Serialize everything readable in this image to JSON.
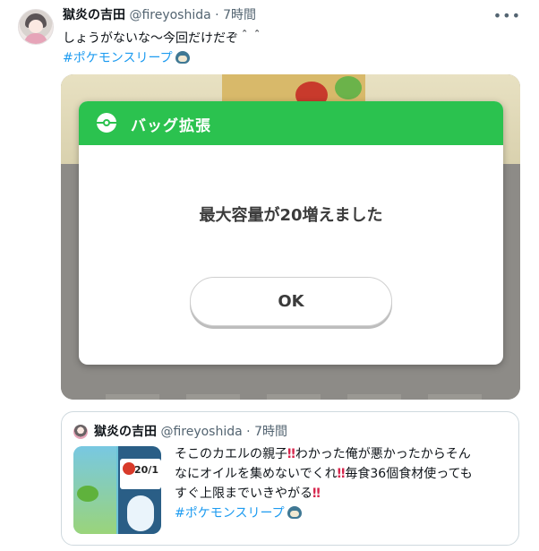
{
  "tweet": {
    "author_name": "獄炎の吉田",
    "handle": "@fireyoshida",
    "separator": "·",
    "time": "7時間",
    "more_icon": "•••",
    "text": "しょうがないな〜今回だけだぞ＾＾",
    "hashtag": "#ポケモンスリープ"
  },
  "dialog": {
    "title": "バッグ拡張",
    "message": "最大容量が20増えました",
    "ok_label": "OK"
  },
  "quote": {
    "author_name": "獄炎の吉田",
    "handle": "@fireyoshida",
    "separator": "·",
    "time": "7時間",
    "line1_a": "そこのカエルの親子",
    "line1_b": "わかった俺が悪かったからそん",
    "line2_a": "なにオイルを集めないでくれ",
    "line2_b": "毎食36個食材使っても",
    "line3_a": "すぐ上限までいきやがる",
    "hashtag": "#ポケモンスリープ",
    "emoji_bangbang": "‼",
    "thumb_text": "20/1"
  },
  "colors": {
    "accent_green": "#2bc24f",
    "link_blue": "#1d9bf0",
    "bangbang_red": "#d6264c"
  }
}
